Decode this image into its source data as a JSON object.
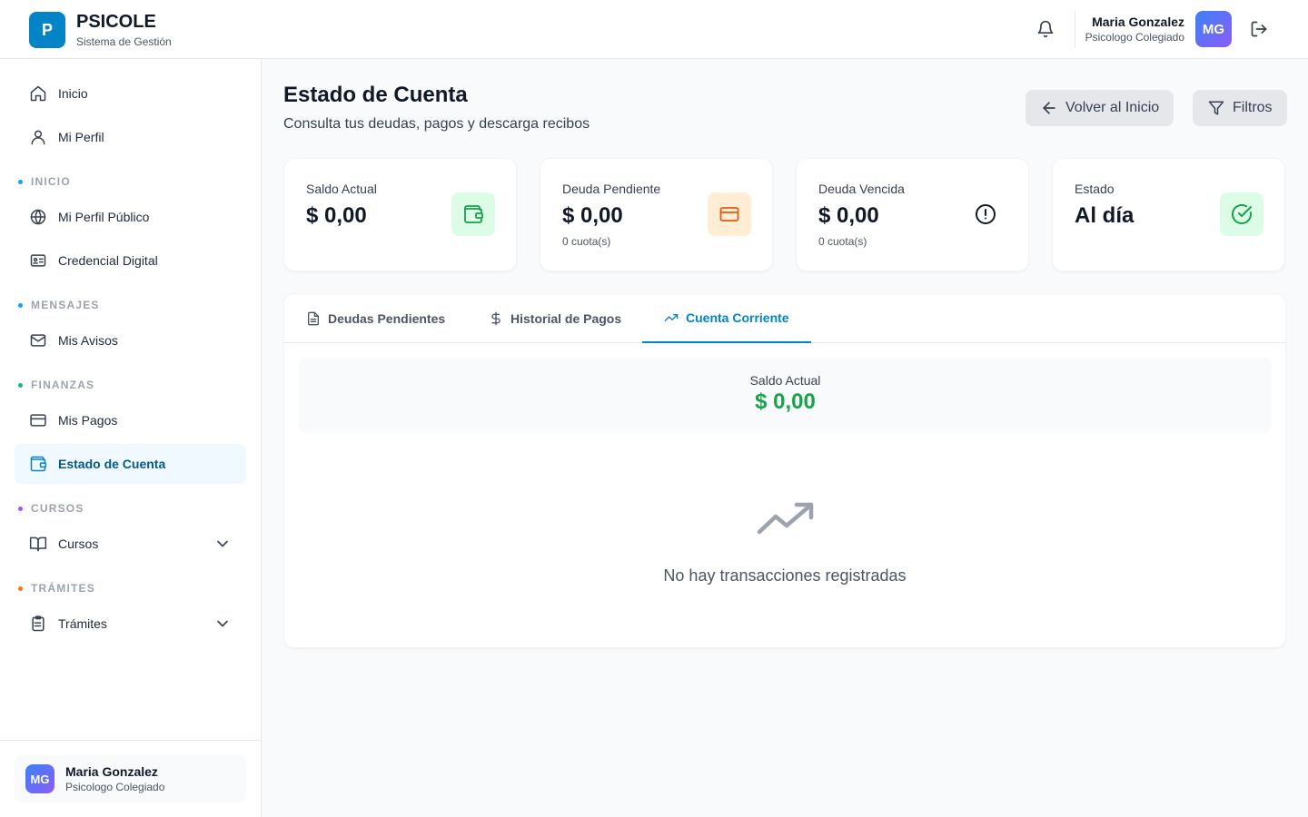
{
  "brand": {
    "logo_letter": "P",
    "name": "PSICOLE",
    "subtitle": "Sistema de Gestión"
  },
  "header": {
    "user_name": "Maria Gonzalez",
    "user_role": "Psicologo Colegiado",
    "avatar_initials": "MG",
    "icons": [
      "bell-icon",
      "logout-icon"
    ]
  },
  "sidebar": {
    "top_items": [
      {
        "label": "Inicio",
        "icon": "home-icon"
      },
      {
        "label": "Mi Perfil",
        "icon": "user-icon"
      }
    ],
    "sections": [
      {
        "title": "INICIO",
        "dot_color": "#0ea5e9",
        "items": [
          {
            "label": "Mi Perfil Público",
            "icon": "globe-icon"
          },
          {
            "label": "Credencial Digital",
            "icon": "id-card-icon"
          }
        ]
      },
      {
        "title": "MENSAJES",
        "dot_color": "#0ea5e9",
        "items": [
          {
            "label": "Mis Avisos",
            "icon": "mail-icon"
          }
        ]
      },
      {
        "title": "FINANZAS",
        "dot_color": "#10b981",
        "items": [
          {
            "label": "Mis Pagos",
            "icon": "credit-card-icon"
          },
          {
            "label": "Estado de Cuenta",
            "icon": "wallet-icon",
            "active": true
          }
        ]
      },
      {
        "title": "CURSOS",
        "dot_color": "#a855f7",
        "items": [
          {
            "label": "Cursos",
            "icon": "book-icon",
            "expandable": true
          }
        ]
      },
      {
        "title": "TRÁMITES",
        "dot_color": "#f97316",
        "items": [
          {
            "label": "Trámites",
            "icon": "clipboard-icon",
            "expandable": true
          }
        ]
      }
    ],
    "footer": {
      "avatar_initials": "MG",
      "name": "Maria Gonzalez",
      "role": "Psicologo Colegiado"
    }
  },
  "page": {
    "title": "Estado de Cuenta",
    "subtitle": "Consulta tus deudas, pagos y descarga recibos",
    "back_button": "Volver al Inicio",
    "filters_button": "Filtros"
  },
  "stats": [
    {
      "label": "Saldo Actual",
      "value": "$ 0,00",
      "sub": "",
      "icon": "wallet-icon",
      "icon_bg": "#dcfce7",
      "icon_color": "#16a34a"
    },
    {
      "label": "Deuda Pendiente",
      "value": "$ 0,00",
      "sub": "0 cuota(s)",
      "icon": "credit-card-icon",
      "icon_bg": "#ffedd5",
      "icon_color": "#ea580c"
    },
    {
      "label": "Deuda Vencida",
      "value": "$ 0,00",
      "sub": "0 cuota(s)",
      "icon": "alert-circle-icon",
      "icon_bg": "#ffffff",
      "icon_color": "#111827"
    },
    {
      "label": "Estado",
      "value": "Al día",
      "sub": "",
      "icon": "check-circle-icon",
      "icon_bg": "#dcfce7",
      "icon_color": "#16a34a"
    }
  ],
  "tabs": [
    {
      "label": "Deudas Pendientes",
      "icon": "file-text-icon"
    },
    {
      "label": "Historial de Pagos",
      "icon": "dollar-icon"
    },
    {
      "label": "Cuenta Corriente",
      "icon": "trending-up-icon",
      "active": true
    }
  ],
  "current_account": {
    "balance_label": "Saldo Actual",
    "balance_value": "$ 0,00",
    "empty_icon": "trending-up-icon",
    "empty_message": "No hay transacciones registradas"
  },
  "colors": {
    "accent": "#0284c7",
    "success": "#16a34a",
    "warning": "#ea580c"
  }
}
